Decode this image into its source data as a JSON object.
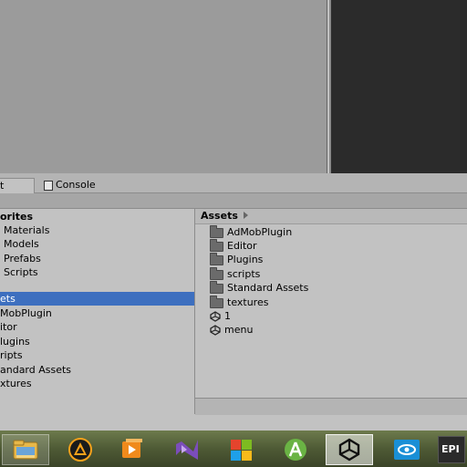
{
  "tabs": {
    "project_label": "t",
    "console_label": "Console"
  },
  "favorites": {
    "header": "orites",
    "items": [
      "Materials",
      "Models",
      "Prefabs",
      "Scripts"
    ]
  },
  "assets_tree": {
    "root": "ets",
    "children": [
      "MobPlugin",
      "itor",
      "lugins",
      "ripts",
      "andard Assets",
      "xtures"
    ]
  },
  "assets_view": {
    "breadcrumb": "Assets",
    "folders": [
      "AdMobPlugin",
      "Editor",
      "Plugins",
      "scripts",
      "Standard Assets",
      "textures"
    ],
    "scenes": [
      "1",
      "menu"
    ]
  },
  "taskbar": {
    "items": [
      "file-explorer",
      "aimp",
      "media-player",
      "visual-studio",
      "microsoft-office",
      "android-studio",
      "unity",
      "tv-app",
      "epic-games"
    ],
    "epic_label": "EPI",
    "colors": {
      "unity_active_bg": "#e6e6e6",
      "selection": "#3d6fbf"
    }
  }
}
